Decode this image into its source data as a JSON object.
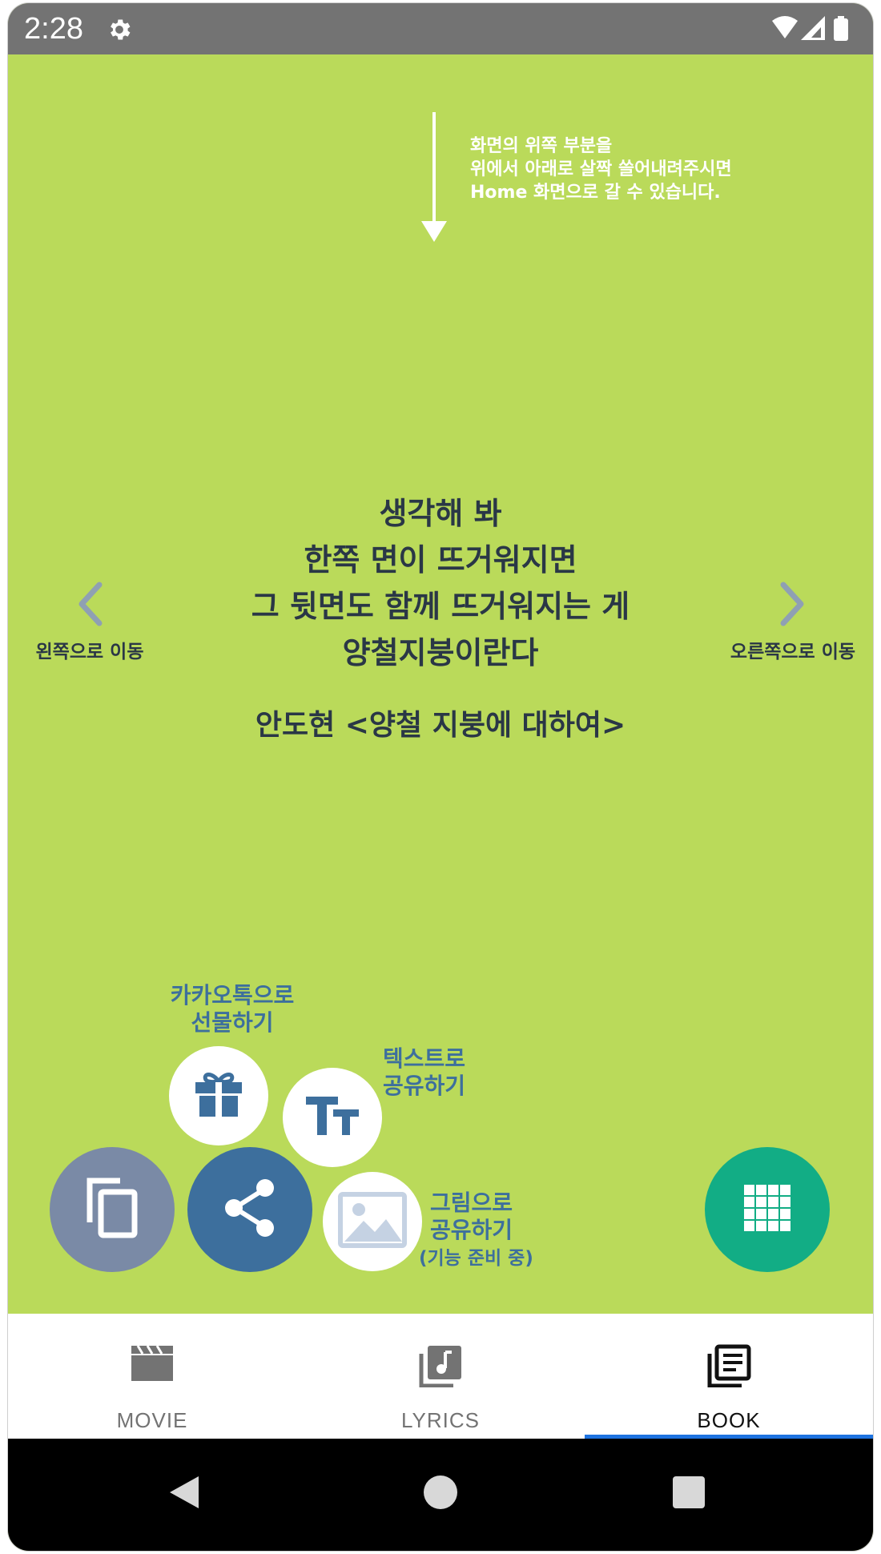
{
  "status_bar": {
    "time": "2:28",
    "settings_icon": "gear-icon",
    "wifi_icon": "wifi-icon",
    "signal_icon": "signal-icon",
    "battery_icon": "battery-icon"
  },
  "hint": {
    "lines": [
      "화면의 위쪽 부분을",
      "위에서 아래로 살짝 쓸어내려주시면",
      "Home 화면으로 갈 수 있습니다."
    ],
    "icon": "arrow-down-icon"
  },
  "quote": {
    "lines": [
      "생각해 봐",
      "한쪽 면이 뜨거워지면",
      "그 뒷면도 함께 뜨거워지는 게",
      "양철지붕이란다"
    ],
    "author": "안도현 <양철 지붕에 대하여>"
  },
  "nav": {
    "left_label": "왼쪽으로 이동",
    "right_label": "오른쪽으로 이동"
  },
  "actions": {
    "gift_label_lines": [
      "카카오톡으로",
      "선물하기"
    ],
    "text_share_label_lines": [
      "텍스트로",
      "공유하기"
    ],
    "image_share_label_lines": [
      "그림으로",
      "공유하기"
    ],
    "image_share_note": "(기능 준비 중)",
    "text_icon_glyph": "TT"
  },
  "bottom_nav": {
    "tabs": [
      {
        "label": "MOVIE",
        "icon": "clapperboard-icon"
      },
      {
        "label": "LYRICS",
        "icon": "music-library-icon"
      },
      {
        "label": "BOOK",
        "icon": "book-icon",
        "selected": true
      }
    ]
  },
  "colors": {
    "background": "#bada5a",
    "text": "#2a3746",
    "accent_blue": "#3d6f9d",
    "copy_button": "#7a8aa6",
    "menu_button": "#12ad85",
    "tab_selected_indicator": "#1e73e0"
  }
}
